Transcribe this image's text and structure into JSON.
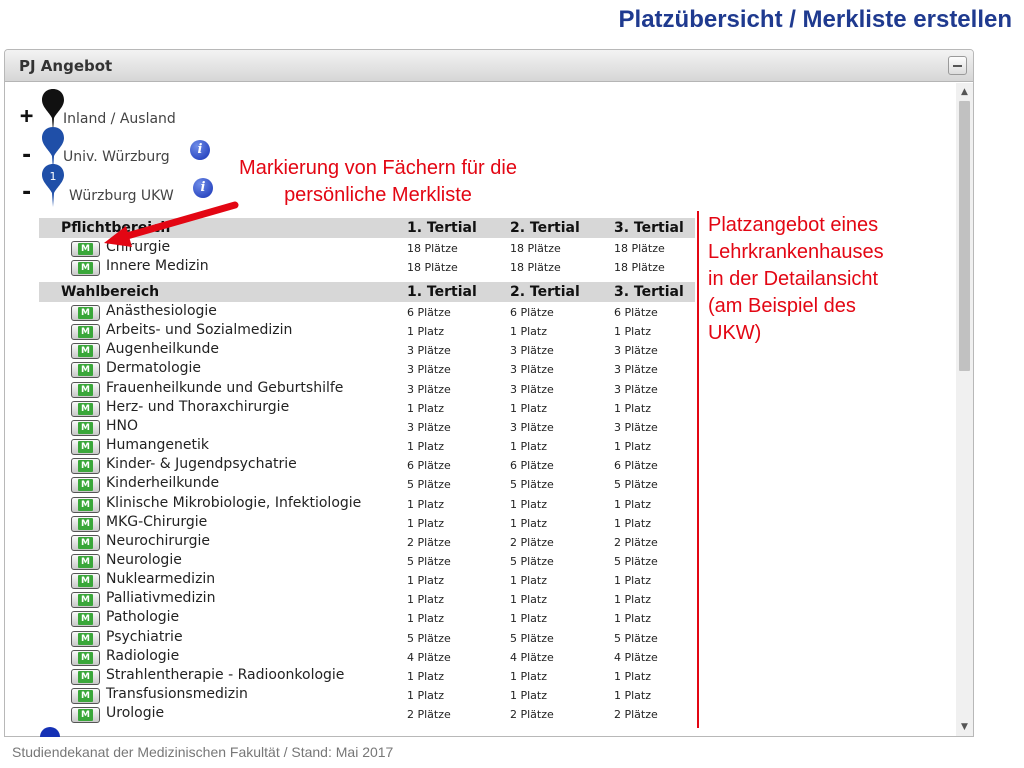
{
  "slide": {
    "title": "Platzübersicht / Merkliste erstellen",
    "footer": "Studiendekanat der Medizinischen Fakultät / Stand: Mai 2017"
  },
  "panel": {
    "title": "PJ Angebot"
  },
  "tree": {
    "inland": {
      "toggle": "+",
      "label": "Inland / Ausland"
    },
    "univ": {
      "toggle": "-",
      "label": "Univ. Würzburg"
    },
    "ukw": {
      "toggle": "-",
      "label": "Würzburg UKW",
      "pin_number": "1"
    }
  },
  "icons": {
    "info": "i",
    "marker_button": "M"
  },
  "pflicht": {
    "header": "Pflichtbereich",
    "cols": [
      "1. Tertial",
      "2. Tertial",
      "3. Tertial"
    ],
    "rows": [
      {
        "name": "Chirurgie",
        "t1": "18 Plätze",
        "t2": "18 Plätze",
        "t3": "18 Plätze"
      },
      {
        "name": "Innere Medizin",
        "t1": "18 Plätze",
        "t2": "18 Plätze",
        "t3": "18 Plätze"
      }
    ]
  },
  "wahl": {
    "header": "Wahlbereich",
    "cols": [
      "1. Tertial",
      "2. Tertial",
      "3. Tertial"
    ],
    "rows": [
      {
        "name": "Anästhesiologie",
        "t1": "6 Plätze",
        "t2": "6 Plätze",
        "t3": "6 Plätze"
      },
      {
        "name": "Arbeits- und Sozialmedizin",
        "t1": "1 Platz",
        "t2": "1 Platz",
        "t3": "1 Platz"
      },
      {
        "name": "Augenheilkunde",
        "t1": "3 Plätze",
        "t2": "3 Plätze",
        "t3": "3 Plätze"
      },
      {
        "name": "Dermatologie",
        "t1": "3 Plätze",
        "t2": "3 Plätze",
        "t3": "3 Plätze"
      },
      {
        "name": "Frauenheilkunde und Geburtshilfe",
        "t1": "3 Plätze",
        "t2": "3 Plätze",
        "t3": "3 Plätze"
      },
      {
        "name": "Herz- und Thoraxchirurgie",
        "t1": "1 Platz",
        "t2": "1 Platz",
        "t3": "1 Platz"
      },
      {
        "name": "HNO",
        "t1": "3 Plätze",
        "t2": "3 Plätze",
        "t3": "3 Plätze"
      },
      {
        "name": "Humangenetik",
        "t1": "1 Platz",
        "t2": "1 Platz",
        "t3": "1 Platz"
      },
      {
        "name": "Kinder- & Jugendpsychatrie",
        "t1": "6 Plätze",
        "t2": "6 Plätze",
        "t3": "6 Plätze"
      },
      {
        "name": "Kinderheilkunde",
        "t1": "5 Plätze",
        "t2": "5 Plätze",
        "t3": "5 Plätze"
      },
      {
        "name": "Klinische Mikrobiologie, Infektiologie",
        "t1": "1 Platz",
        "t2": "1 Platz",
        "t3": "1 Platz"
      },
      {
        "name": "MKG-Chirurgie",
        "t1": "1 Platz",
        "t2": "1 Platz",
        "t3": "1 Platz"
      },
      {
        "name": "Neurochirurgie",
        "t1": "2 Plätze",
        "t2": "2 Plätze",
        "t3": "2 Plätze"
      },
      {
        "name": "Neurologie",
        "t1": "5 Plätze",
        "t2": "5 Plätze",
        "t3": "5 Plätze"
      },
      {
        "name": "Nuklearmedizin",
        "t1": "1 Platz",
        "t2": "1 Platz",
        "t3": "1 Platz"
      },
      {
        "name": "Palliativmedizin",
        "t1": "1 Platz",
        "t2": "1 Platz",
        "t3": "1 Platz"
      },
      {
        "name": "Pathologie",
        "t1": "1 Platz",
        "t2": "1 Platz",
        "t3": "1 Platz"
      },
      {
        "name": "Psychiatrie",
        "t1": "5 Plätze",
        "t2": "5 Plätze",
        "t3": "5 Plätze"
      },
      {
        "name": "Radiologie",
        "t1": "4 Plätze",
        "t2": "4 Plätze",
        "t3": "4 Plätze"
      },
      {
        "name": "Strahlentherapie - Radioonkologie",
        "t1": "1 Platz",
        "t2": "1 Platz",
        "t3": "1 Platz"
      },
      {
        "name": "Transfusionsmedizin",
        "t1": "1 Platz",
        "t2": "1 Platz",
        "t3": "1 Platz"
      },
      {
        "name": "Urologie",
        "t1": "2 Plätze",
        "t2": "2 Plätze",
        "t3": "2 Plätze"
      }
    ]
  },
  "annotations": {
    "marker_note": [
      "Markierung von Fächern für die",
      "persönliche Merkliste"
    ],
    "detail_note": [
      "Platzangebot eines",
      "Lehrkrankenhauses",
      "in der Detailansicht",
      "(am Beispiel des",
      "UKW)"
    ],
    "color": "#e30613"
  },
  "colors": {
    "title": "#1f3a8f",
    "pin_black": "#111111",
    "pin_blue": "#1f4fa8",
    "marker_green": "#3aa73a"
  }
}
